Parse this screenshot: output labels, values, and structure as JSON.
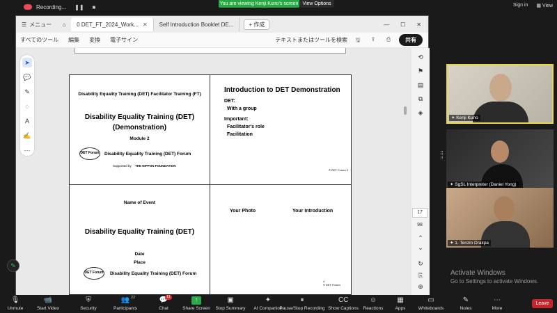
{
  "zoom_top": {
    "recording": "Recording...",
    "share_banner": "You are viewing Kenji Kuno's screen",
    "view_options": "View Options",
    "sign_in": "Sign in",
    "view": "View"
  },
  "acrobat": {
    "menu": "メニュー",
    "tabs": [
      {
        "label": "0 DET_FT_2024_Work..."
      },
      {
        "label": "Self Introduction Booklet DE..."
      }
    ],
    "new_tab": "作成",
    "menubar": [
      "すべてのツール",
      "編集",
      "変換",
      "電子サイン"
    ],
    "search": "テキストまたはツールを検索",
    "share": "共有",
    "page_current": "17",
    "page_total": "98"
  },
  "slides": {
    "s1": {
      "header": "Disability Equality Training (DET) Facilitator Training (FT)",
      "title_line1": "Disability Equality Training (DET)",
      "title_line2": "(Demonstration)",
      "module": "Module 2",
      "forum": "Disability Equality Training (DET) Forum",
      "supported": "Supported by",
      "nippon": "THE NIPPON FOUNDATION",
      "logo": "DET Forum"
    },
    "s2": {
      "title": "Introduction to DET Demonstration",
      "det": "DET:",
      "with_group": "With a group",
      "important": "Important:",
      "role": "Facilitator's role",
      "facilitation": "Facilitation",
      "footer": "© DET Forum",
      "pagenum": "2"
    },
    "s3": {
      "event": "Name of Event",
      "title": "Disability Equality Training (DET)",
      "date": "Date",
      "place": "Place",
      "forum": "Disability Equality Training (DET) Forum",
      "logo": "DET Forum"
    },
    "s4": {
      "photo": "Your Photo",
      "intro": "Your Introduction",
      "footer": "© DET Forum",
      "pagenum": "4"
    }
  },
  "participants": [
    {
      "name": "Kenji Kuno"
    },
    {
      "name": "SgSL Interpreter (Daniel Yong)"
    },
    {
      "name": "1. Tenzin Drakpa"
    }
  ],
  "activate": {
    "line1": "Activate Windows",
    "line2": "Go to Settings to activate Windows."
  },
  "controls": [
    {
      "label": "Unmute",
      "icon": "mic-off-icon"
    },
    {
      "label": "Start Video",
      "icon": "video-off-icon"
    },
    {
      "label": "Security",
      "icon": "shield-icon"
    },
    {
      "label": "Participants",
      "icon": "participants-icon",
      "count": "22"
    },
    {
      "label": "Chat",
      "icon": "chat-icon",
      "badge": "11"
    },
    {
      "label": "Share Screen",
      "icon": "share-screen-icon"
    },
    {
      "label": "Stop Summary",
      "icon": "stop-summary-icon"
    },
    {
      "label": "AI Companion",
      "icon": "ai-companion-icon"
    },
    {
      "label": "Pause/Stop Recording",
      "icon": "recording-icon"
    },
    {
      "label": "Show Captions",
      "icon": "captions-icon"
    },
    {
      "label": "Reactions",
      "icon": "reactions-icon"
    },
    {
      "label": "Apps",
      "icon": "apps-icon"
    },
    {
      "label": "Whiteboards",
      "icon": "whiteboard-icon"
    },
    {
      "label": "Notes",
      "icon": "notes-icon"
    },
    {
      "label": "More",
      "icon": "more-icon"
    }
  ],
  "leave": "Leave",
  "colors": {
    "share_green": "#27a843",
    "leave_red": "#c4262e",
    "active_speaker": "#e6d64a",
    "rec_red": "#e84c5a"
  }
}
